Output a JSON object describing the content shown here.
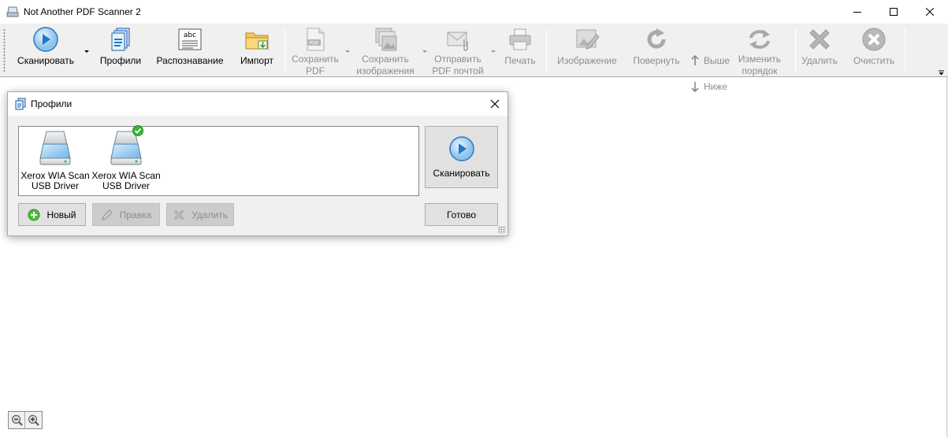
{
  "window": {
    "title": "Not Another PDF Scanner 2"
  },
  "toolbar": {
    "scan": "Сканировать",
    "profiles": "Профили",
    "ocr": "Распознавание",
    "import": "Импорт",
    "save_pdf_1": "Сохранить",
    "save_pdf_2": "PDF",
    "save_images_1": "Сохранить",
    "save_images_2": "изображения",
    "email_pdf_1": "Отправить",
    "email_pdf_2": "PDF почтой",
    "print": "Печать",
    "image": "Изображение",
    "rotate": "Повернуть",
    "move_up": "Выше",
    "move_down": "Ниже",
    "reorder_1": "Изменить",
    "reorder_2": "порядок",
    "delete": "Удалить",
    "clear": "Очистить",
    "colors": {
      "accent": "#1e78c8",
      "disabled": "#8d8d8d",
      "delete_gray": "#b4b4b4"
    }
  },
  "dialog": {
    "title": "Профили",
    "profiles": [
      {
        "name_1": "Xerox WIA Scan",
        "name_2": "USB Driver",
        "is_default": false
      },
      {
        "name_1": "Xerox WIA Scan",
        "name_2": "USB Driver",
        "is_default": true
      }
    ],
    "scan_button": "Сканировать",
    "new_button": "Новый",
    "edit_button": "Правка",
    "delete_button": "Удалить",
    "done_button": "Готово"
  }
}
